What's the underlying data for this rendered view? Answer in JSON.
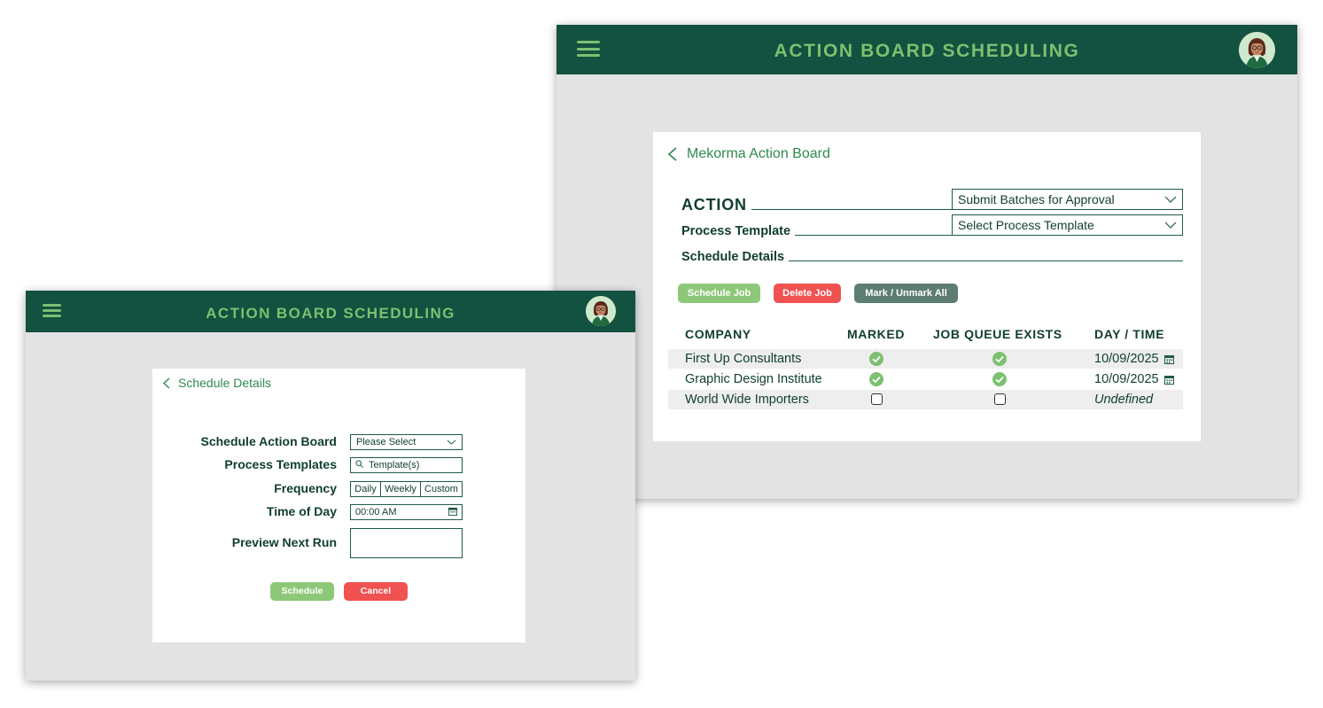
{
  "colors": {
    "header_bg": "#135140",
    "header_text": "#7cc070",
    "window_bg": "#e4e3e4",
    "link_green": "#2e8a4e",
    "button_green": "#8dc878",
    "button_red": "#f05151",
    "button_slate": "#5d7d70"
  },
  "back_window": {
    "app_title": "ACTION BOARD SCHEDULING",
    "back_link": "Mekorma Action Board",
    "action_label": "ACTION",
    "action_value": "Submit Batches for Approval",
    "process_template_label": "Process Template",
    "process_template_value": "Select Process Template",
    "schedule_details_label": "Schedule Details",
    "buttons": {
      "schedule_job": "Schedule Job",
      "delete_job": "Delete Job",
      "mark_unmark_all": "Mark / Unmark All"
    },
    "table": {
      "headers": [
        "COMPANY",
        "MARKED",
        "JOB QUEUE EXISTS",
        "DAY / TIME"
      ],
      "rows": [
        {
          "company": "First Up Consultants",
          "marked": true,
          "job_queue_exists": true,
          "day_time": "10/09/2025"
        },
        {
          "company": "Graphic Design Institute",
          "marked": true,
          "job_queue_exists": true,
          "day_time": "10/09/2025"
        },
        {
          "company": "World Wide Importers",
          "marked": false,
          "job_queue_exists": false,
          "day_time": "Undefined"
        }
      ]
    }
  },
  "front_window": {
    "app_title": "ACTION BOARD SCHEDULING",
    "back_link": "Schedule Details",
    "form": {
      "schedule_action_board_label": "Schedule Action Board",
      "schedule_action_board_value": "Please Select",
      "process_templates_label": "Process Templates",
      "process_templates_placeholder": "Template(s)",
      "frequency_label": "Frequency",
      "frequency_options": [
        "Daily",
        "Weekly",
        "Custom"
      ],
      "time_of_day_label": "Time of Day",
      "time_of_day_value": "00:00 AM",
      "preview_next_run_label": "Preview Next Run",
      "preview_next_run_value": ""
    },
    "buttons": {
      "schedule": "Schedule",
      "cancel": "Cancel"
    }
  },
  "icons": [
    "menu-icon",
    "avatar-icon",
    "chevron-left-icon",
    "chevron-down-icon",
    "check-circle-icon",
    "calendar-icon",
    "search-icon"
  ]
}
